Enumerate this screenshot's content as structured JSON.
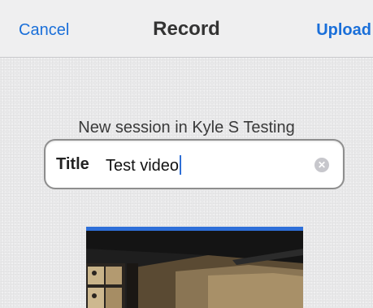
{
  "navbar": {
    "cancel_label": "Cancel",
    "title": "Record",
    "upload_label": "Upload"
  },
  "session": {
    "label": "New session in Kyle S Testing"
  },
  "title_field": {
    "label": "Title",
    "value": "Test video"
  },
  "icons": {
    "clear": "clear-icon"
  },
  "colors": {
    "accent": "#1a6fd9",
    "video_border": "#2e6fd8"
  }
}
